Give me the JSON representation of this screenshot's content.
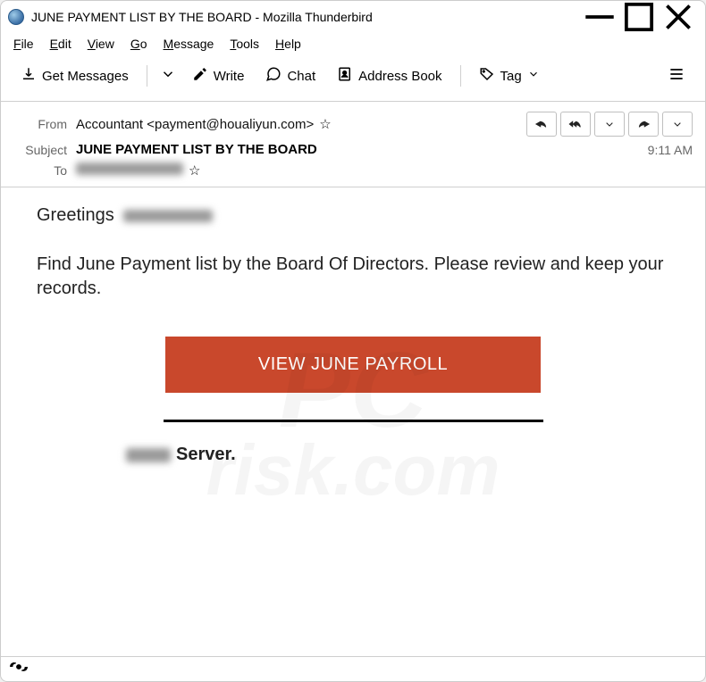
{
  "window": {
    "title": "JUNE PAYMENT LIST BY THE BOARD - Mozilla Thunderbird"
  },
  "menubar": {
    "file": "File",
    "edit": "Edit",
    "view": "View",
    "go": "Go",
    "message": "Message",
    "tools": "Tools",
    "help": "Help"
  },
  "toolbar": {
    "get_messages": "Get Messages",
    "write": "Write",
    "chat": "Chat",
    "address_book": "Address Book",
    "tag": "Tag"
  },
  "headers": {
    "from_label": "From",
    "from_value": "Accountant <payment@houaliyun.com>",
    "subject_label": "Subject",
    "subject_value": "JUNE PAYMENT LIST BY THE BOARD",
    "to_label": "To",
    "time": "9:11 AM"
  },
  "body": {
    "greeting_prefix": "Greetings",
    "main_text": "Find June Payment list by the Board Of Directors.  Please review and keep your records.",
    "cta_label": "VIEW JUNE PAYROLL",
    "signature_suffix": "Server."
  },
  "watermark": {
    "line1": "PC",
    "line2": "risk.com"
  }
}
